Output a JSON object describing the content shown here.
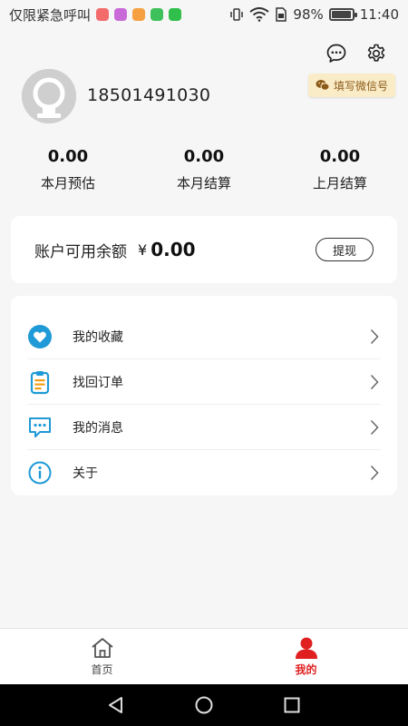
{
  "status_bar": {
    "carrier": "仅限紧急呼叫",
    "battery": "98%",
    "battery_level": 0.98,
    "time": "11:40"
  },
  "header": {
    "wechat_badge": "填写微信号",
    "phone": "18501491030"
  },
  "stats": [
    {
      "value": "0.00",
      "label": "本月预估"
    },
    {
      "value": "0.00",
      "label": "本月结算"
    },
    {
      "value": "0.00",
      "label": "上月结算"
    }
  ],
  "balance": {
    "label": "账户可用余额",
    "currency": "¥",
    "amount": "0.00",
    "withdraw": "提现"
  },
  "menu": [
    {
      "label": "我的收藏",
      "icon": "heart-icon"
    },
    {
      "label": "找回订单",
      "icon": "clipboard-icon"
    },
    {
      "label": "我的消息",
      "icon": "message-icon"
    },
    {
      "label": "关于",
      "icon": "info-icon"
    }
  ],
  "bottom_nav": {
    "home": "首页",
    "mine": "我的"
  },
  "colors": {
    "accent_red": "#e02020",
    "icon_blue": "#1f9ad6",
    "icon_orange": "#f39c12",
    "badge_bg": "#fbecc8"
  }
}
